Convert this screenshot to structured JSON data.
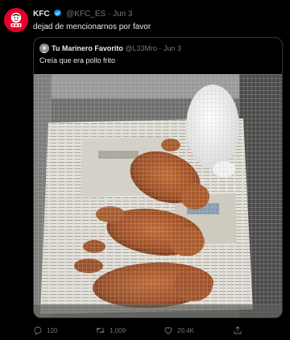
{
  "tweet": {
    "author_name": "KFC",
    "author_handle": "@KFC_ES",
    "separator": "·",
    "date": "Jun 3",
    "text": "dejad de mencionarnos por favor",
    "avatar_icon": "kfc-logo",
    "verified_icon": "verified-badge-icon",
    "brand_color": "#e4002b"
  },
  "quote": {
    "author_name": "Tu Marinero Favorito",
    "author_handle": "@L33Mro",
    "separator": "·",
    "date": "Jun 3",
    "text": "Creía que era pollo frito",
    "media": "photo of brown poodle puppies lying on newspaper inside a wire cage, with a white puppy"
  },
  "actions": {
    "replies": {
      "icon": "reply-icon",
      "count": "120"
    },
    "retweets": {
      "icon": "retweet-icon",
      "count": "1,009"
    },
    "likes": {
      "icon": "heart-icon",
      "count": "20.4K"
    },
    "share": {
      "icon": "share-icon"
    }
  },
  "colors": {
    "background": "#000000",
    "text": "#e7e9ea",
    "muted": "#71767b",
    "verified": "#1d9bf0",
    "border": "#333639"
  }
}
